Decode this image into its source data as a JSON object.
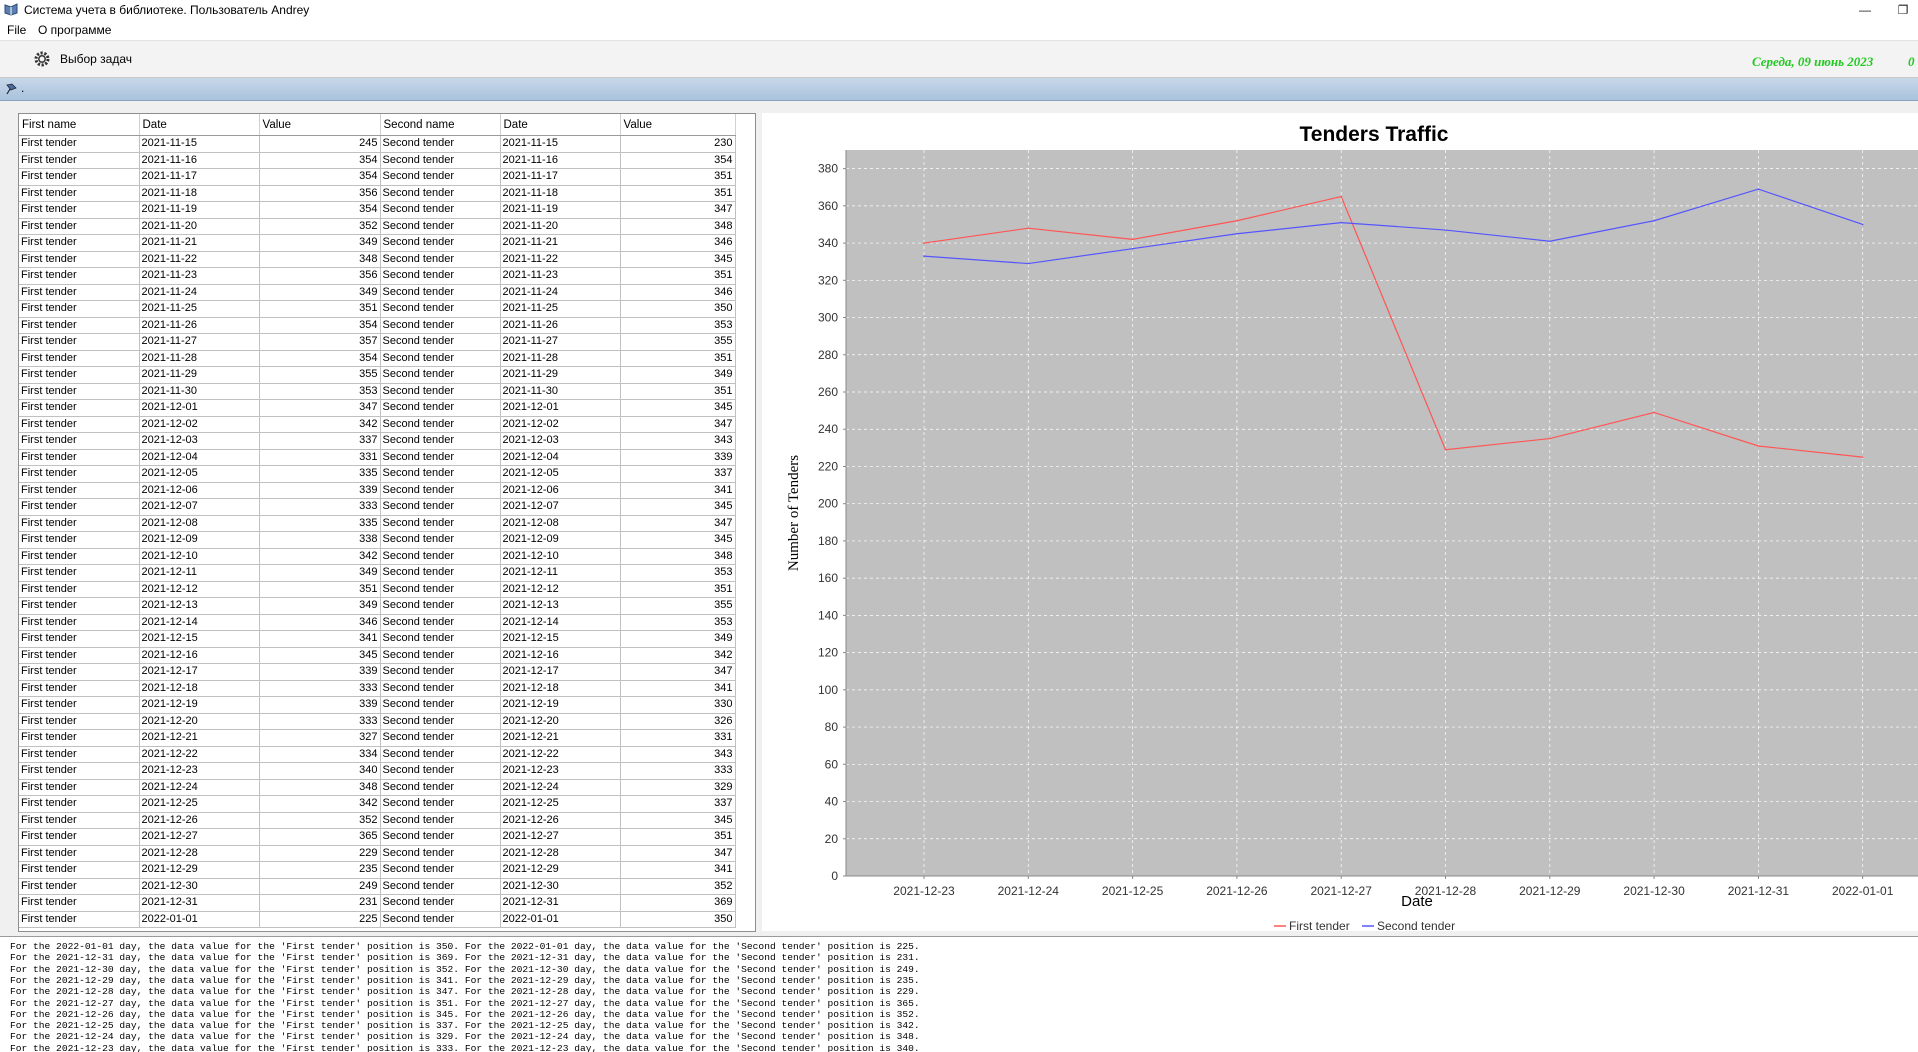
{
  "window": {
    "title": "Система учета в библиотеке. Пользователь Andrey",
    "minimize_glyph": "—",
    "maximize_glyph": "❐"
  },
  "menu": {
    "items": [
      "File",
      "О программе"
    ]
  },
  "toolbar": {
    "task_label": "Выбор задач",
    "date_text": "Середа, 09 июнь 2023",
    "trailing_text": "0"
  },
  "strip": {
    "label": "."
  },
  "table": {
    "columns": [
      "First name",
      "Date",
      "Value",
      "Second name",
      "Date",
      "Value"
    ],
    "rows": [
      [
        "First tender",
        "2021-11-15",
        "245",
        "Second tender",
        "2021-11-15",
        "230"
      ],
      [
        "First tender",
        "2021-11-16",
        "354",
        "Second tender",
        "2021-11-16",
        "354"
      ],
      [
        "First tender",
        "2021-11-17",
        "354",
        "Second tender",
        "2021-11-17",
        "351"
      ],
      [
        "First tender",
        "2021-11-18",
        "356",
        "Second tender",
        "2021-11-18",
        "351"
      ],
      [
        "First tender",
        "2021-11-19",
        "354",
        "Second tender",
        "2021-11-19",
        "347"
      ],
      [
        "First tender",
        "2021-11-20",
        "352",
        "Second tender",
        "2021-11-20",
        "348"
      ],
      [
        "First tender",
        "2021-11-21",
        "349",
        "Second tender",
        "2021-11-21",
        "346"
      ],
      [
        "First tender",
        "2021-11-22",
        "348",
        "Second tender",
        "2021-11-22",
        "345"
      ],
      [
        "First tender",
        "2021-11-23",
        "356",
        "Second tender",
        "2021-11-23",
        "351"
      ],
      [
        "First tender",
        "2021-11-24",
        "349",
        "Second tender",
        "2021-11-24",
        "346"
      ],
      [
        "First tender",
        "2021-11-25",
        "351",
        "Second tender",
        "2021-11-25",
        "350"
      ],
      [
        "First tender",
        "2021-11-26",
        "354",
        "Second tender",
        "2021-11-26",
        "353"
      ],
      [
        "First tender",
        "2021-11-27",
        "357",
        "Second tender",
        "2021-11-27",
        "355"
      ],
      [
        "First tender",
        "2021-11-28",
        "354",
        "Second tender",
        "2021-11-28",
        "351"
      ],
      [
        "First tender",
        "2021-11-29",
        "355",
        "Second tender",
        "2021-11-29",
        "349"
      ],
      [
        "First tender",
        "2021-11-30",
        "353",
        "Second tender",
        "2021-11-30",
        "351"
      ],
      [
        "First tender",
        "2021-12-01",
        "347",
        "Second tender",
        "2021-12-01",
        "345"
      ],
      [
        "First tender",
        "2021-12-02",
        "342",
        "Second tender",
        "2021-12-02",
        "347"
      ],
      [
        "First tender",
        "2021-12-03",
        "337",
        "Second tender",
        "2021-12-03",
        "343"
      ],
      [
        "First tender",
        "2021-12-04",
        "331",
        "Second tender",
        "2021-12-04",
        "339"
      ],
      [
        "First tender",
        "2021-12-05",
        "335",
        "Second tender",
        "2021-12-05",
        "337"
      ],
      [
        "First tender",
        "2021-12-06",
        "339",
        "Second tender",
        "2021-12-06",
        "341"
      ],
      [
        "First tender",
        "2021-12-07",
        "333",
        "Second tender",
        "2021-12-07",
        "345"
      ],
      [
        "First tender",
        "2021-12-08",
        "335",
        "Second tender",
        "2021-12-08",
        "347"
      ],
      [
        "First tender",
        "2021-12-09",
        "338",
        "Second tender",
        "2021-12-09",
        "345"
      ],
      [
        "First tender",
        "2021-12-10",
        "342",
        "Second tender",
        "2021-12-10",
        "348"
      ],
      [
        "First tender",
        "2021-12-11",
        "349",
        "Second tender",
        "2021-12-11",
        "353"
      ],
      [
        "First tender",
        "2021-12-12",
        "351",
        "Second tender",
        "2021-12-12",
        "351"
      ],
      [
        "First tender",
        "2021-12-13",
        "349",
        "Second tender",
        "2021-12-13",
        "355"
      ],
      [
        "First tender",
        "2021-12-14",
        "346",
        "Second tender",
        "2021-12-14",
        "353"
      ],
      [
        "First tender",
        "2021-12-15",
        "341",
        "Second tender",
        "2021-12-15",
        "349"
      ],
      [
        "First tender",
        "2021-12-16",
        "345",
        "Second tender",
        "2021-12-16",
        "342"
      ],
      [
        "First tender",
        "2021-12-17",
        "339",
        "Second tender",
        "2021-12-17",
        "347"
      ],
      [
        "First tender",
        "2021-12-18",
        "333",
        "Second tender",
        "2021-12-18",
        "341"
      ],
      [
        "First tender",
        "2021-12-19",
        "339",
        "Second tender",
        "2021-12-19",
        "330"
      ],
      [
        "First tender",
        "2021-12-20",
        "333",
        "Second tender",
        "2021-12-20",
        "326"
      ],
      [
        "First tender",
        "2021-12-21",
        "327",
        "Second tender",
        "2021-12-21",
        "331"
      ],
      [
        "First tender",
        "2021-12-22",
        "334",
        "Second tender",
        "2021-12-22",
        "343"
      ],
      [
        "First tender",
        "2021-12-23",
        "340",
        "Second tender",
        "2021-12-23",
        "333"
      ],
      [
        "First tender",
        "2021-12-24",
        "348",
        "Second tender",
        "2021-12-24",
        "329"
      ],
      [
        "First tender",
        "2021-12-25",
        "342",
        "Second tender",
        "2021-12-25",
        "337"
      ],
      [
        "First tender",
        "2021-12-26",
        "352",
        "Second tender",
        "2021-12-26",
        "345"
      ],
      [
        "First tender",
        "2021-12-27",
        "365",
        "Second tender",
        "2021-12-27",
        "351"
      ],
      [
        "First tender",
        "2021-12-28",
        "229",
        "Second tender",
        "2021-12-28",
        "347"
      ],
      [
        "First tender",
        "2021-12-29",
        "235",
        "Second tender",
        "2021-12-29",
        "341"
      ],
      [
        "First tender",
        "2021-12-30",
        "249",
        "Second tender",
        "2021-12-30",
        "352"
      ],
      [
        "First tender",
        "2021-12-31",
        "231",
        "Second tender",
        "2021-12-31",
        "369"
      ],
      [
        "First tender",
        "2022-01-01",
        "225",
        "Second tender",
        "2022-01-01",
        "350"
      ]
    ]
  },
  "chart_data": {
    "type": "line",
    "title": "Tenders Traffic",
    "xlabel": "Date",
    "ylabel": "Number of Tenders",
    "categories": [
      "2021-12-23",
      "2021-12-24",
      "2021-12-25",
      "2021-12-26",
      "2021-12-27",
      "2021-12-28",
      "2021-12-29",
      "2021-12-30",
      "2021-12-31",
      "2022-01-01"
    ],
    "series": [
      {
        "name": "First tender",
        "color": "#ff5555",
        "values": [
          340,
          348,
          342,
          352,
          365,
          229,
          235,
          249,
          231,
          225
        ]
      },
      {
        "name": "Second tender",
        "color": "#5555ff",
        "values": [
          333,
          329,
          337,
          345,
          351,
          347,
          341,
          352,
          369,
          350
        ]
      }
    ],
    "ylim": [
      0,
      390
    ],
    "yticks": [
      0,
      20,
      40,
      60,
      80,
      100,
      120,
      140,
      160,
      180,
      200,
      220,
      240,
      260,
      280,
      300,
      320,
      340,
      360,
      380
    ],
    "plot_background": "#c0c0c0",
    "grid": true,
    "legend_position": "bottom"
  },
  "log": {
    "lines": [
      "For the 2022-01-01 day, the data value for the 'First tender' position is 350. For the 2022-01-01 day, the data value for the 'Second tender' position is 225.",
      "For the 2021-12-31 day, the data value for the 'First tender' position is 369. For the 2021-12-31 day, the data value for the 'Second tender' position is 231.",
      "For the 2021-12-30 day, the data value for the 'First tender' position is 352. For the 2021-12-30 day, the data value for the 'Second tender' position is 249.",
      "For the 2021-12-29 day, the data value for the 'First tender' position is 341. For the 2021-12-29 day, the data value for the 'Second tender' position is 235.",
      "For the 2021-12-28 day, the data value for the 'First tender' position is 347. For the 2021-12-28 day, the data value for the 'Second tender' position is 229.",
      "For the 2021-12-27 day, the data value for the 'First tender' position is 351. For the 2021-12-27 day, the data value for the 'Second tender' position is 365.",
      "For the 2021-12-26 day, the data value for the 'First tender' position is 345. For the 2021-12-26 day, the data value for the 'Second tender' position is 352.",
      "For the 2021-12-25 day, the data value for the 'First tender' position is 337. For the 2021-12-25 day, the data value for the 'Second tender' position is 342.",
      "For the 2021-12-24 day, the data value for the 'First tender' position is 329. For the 2021-12-24 day, the data value for the 'Second tender' position is 348.",
      "For the 2021-12-23 day, the data value for the 'First tender' position is 333. For the 2021-12-23 day, the data value for the 'Second tender' position is 340."
    ]
  }
}
